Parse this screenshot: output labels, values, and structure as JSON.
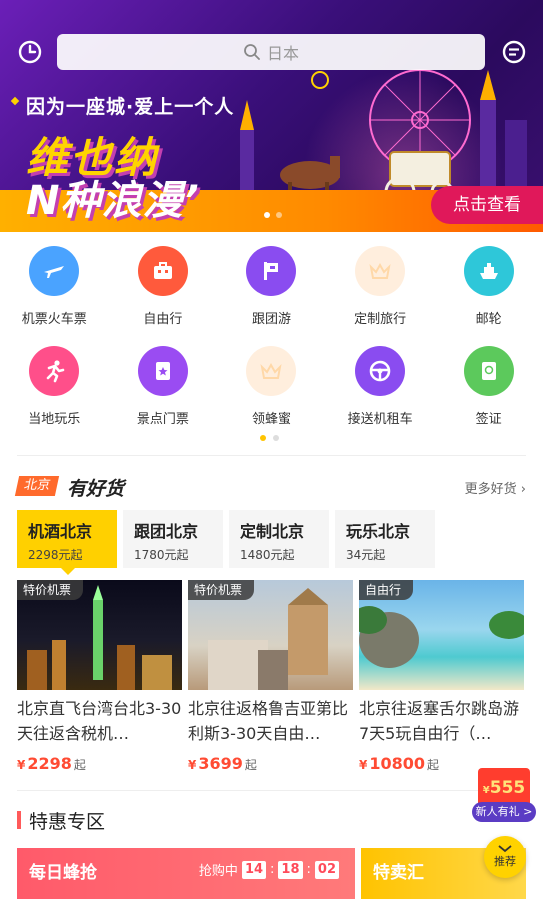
{
  "search": {
    "placeholder": "日本"
  },
  "banner": {
    "tagline": "因为一座城·爱上一个人",
    "title1": "维也纳",
    "title2": "N种浪漫’",
    "cta": "点击查看"
  },
  "categories": [
    {
      "label": "机票火车票",
      "color": "#4aa3ff",
      "icon": "plane-train-icon"
    },
    {
      "label": "自由行",
      "color": "#ff5a3c",
      "icon": "suitcase-icon"
    },
    {
      "label": "跟团游",
      "color": "#8a4cf0",
      "icon": "flag-icon"
    },
    {
      "label": "定制旅行",
      "color": "#ffe7c7",
      "icon": "crown-icon"
    },
    {
      "label": "邮轮",
      "color": "#2ec7d9",
      "icon": "ship-icon"
    },
    {
      "label": "当地玩乐",
      "color": "#ff4f8a",
      "icon": "runner-icon"
    },
    {
      "label": "景点门票",
      "color": "#9a4cf2",
      "icon": "ticket-icon"
    },
    {
      "label": "领蜂蜜",
      "color": "#ffe7c7",
      "icon": "crown-icon"
    },
    {
      "label": "接送机租车",
      "color": "#8a4cf0",
      "icon": "steering-wheel-icon"
    },
    {
      "label": "签证",
      "color": "#5cc95c",
      "icon": "passport-icon"
    }
  ],
  "deals": {
    "city": "北京",
    "title": "有好货",
    "more": "更多好货",
    "tabs": [
      {
        "name": "机酒北京",
        "price": "2298元起"
      },
      {
        "name": "跟团北京",
        "price": "1780元起"
      },
      {
        "name": "定制北京",
        "price": "1480元起"
      },
      {
        "name": "玩乐北京",
        "price": "34元起"
      }
    ],
    "cards": [
      {
        "badge": "特价机票",
        "name": "北京直飞台湾台北3-30天往返含税机…",
        "price": "2298",
        "currency": "¥",
        "suffix": "起"
      },
      {
        "badge": "特价机票",
        "name": "北京往返格鲁吉亚第比利斯3-30天自由…",
        "price": "3699",
        "currency": "¥",
        "suffix": "起"
      },
      {
        "badge": "自由行",
        "name": "北京往返塞舌尔跳岛游7天5玩自由行（…",
        "price": "10800",
        "currency": "¥",
        "suffix": "起"
      }
    ]
  },
  "special": {
    "title": "特惠专区",
    "flash_title": "每日蜂抢",
    "flash_status": "抢购中",
    "countdown": [
      "14",
      "18",
      "02"
    ],
    "sale_title": "特卖汇"
  },
  "gift": {
    "amount": "555",
    "currency": "¥",
    "label": "新人有礼 >"
  },
  "recommend": {
    "label": "推荐"
  }
}
